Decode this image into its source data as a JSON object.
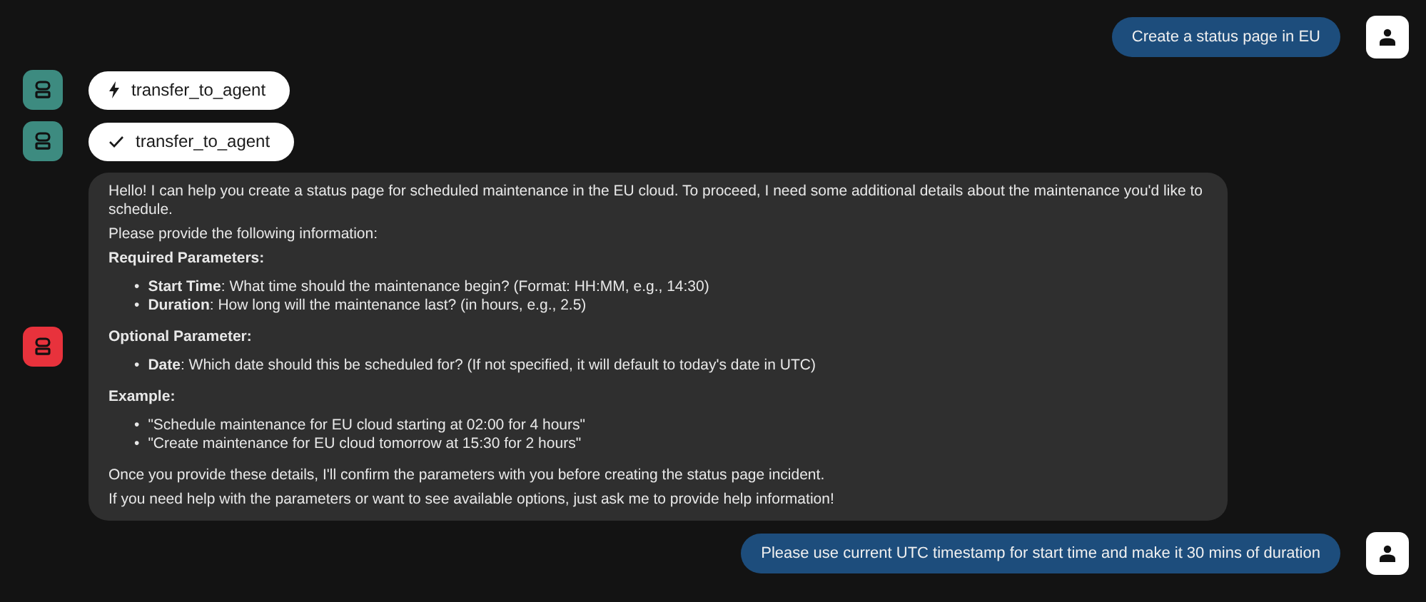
{
  "messages": [
    {
      "kind": "user",
      "text": "Create a status page in EU"
    },
    {
      "kind": "tool_call",
      "color": "#3d8b80",
      "done": false,
      "text": "transfer_to_agent"
    },
    {
      "kind": "tool_call",
      "color": "#3d8b80",
      "done": true,
      "text": "transfer_to_agent"
    },
    {
      "kind": "bot",
      "color": "#e8323c",
      "blocks": [
        {
          "kind": "paragraph",
          "text": "Hello! I can help you create a status page for scheduled maintenance in the EU cloud. To proceed, I need some additional details about the maintenance you'd like to schedule."
        },
        {
          "kind": "paragraph",
          "text": "Please provide the following information:"
        },
        {
          "kind": "heading",
          "text": "Required Parameters:"
        },
        {
          "kind": "list",
          "marker": "•",
          "items": [
            "**Start Time**: What time should the maintenance begin? (Format: HH:MM, e.g., 14:30)",
            "**Duration**: How long will the maintenance last? (in hours, e.g., 2.5)"
          ]
        },
        {
          "kind": "heading",
          "text": "Optional Parameter:"
        },
        {
          "kind": "list",
          "marker": "•",
          "items": [
            "**Date**: Which date should this be scheduled for? (If not specified, it will default to today's date in UTC)"
          ]
        },
        {
          "kind": "heading",
          "text": "Example:"
        },
        {
          "kind": "list",
          "marker": "•",
          "items": [
            "\"Schedule maintenance for EU cloud starting at 02:00 for 4 hours\"",
            "\"Create maintenance for EU cloud tomorrow at 15:30 for 2 hours\""
          ]
        },
        {
          "kind": "paragraph",
          "text": "Once you provide these details, I'll confirm the parameters with you before creating the status page incident."
        },
        {
          "kind": "paragraph",
          "text": "If you need help with the parameters or want to see available options, just ask me to provide help information!"
        }
      ]
    },
    {
      "kind": "user",
      "text": "Please use current UTC timestamp for start time and make it 30 mins of duration"
    }
  ]
}
